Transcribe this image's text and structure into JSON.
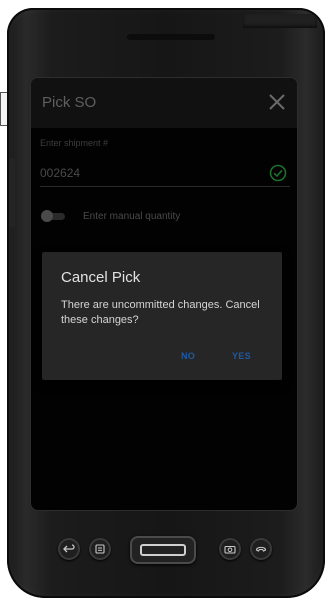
{
  "app": {
    "title": "Pick SO"
  },
  "form": {
    "shipment_label": "Enter shipment #",
    "shipment_value": "002624",
    "manual_quantity_label": "Enter manual quantity",
    "manual_quantity_enabled": false
  },
  "dialog": {
    "title": "Cancel Pick",
    "message": "There are uncommitted changes. Cancel these changes?",
    "no_label": "NO",
    "yes_label": "YES"
  },
  "icons": {
    "close": "close-icon",
    "valid": "check-circle-icon",
    "hw_back": "back-icon",
    "hw_menu": "menu-icon",
    "hw_scan": "scan-trigger-icon",
    "hw_camera": "camera-icon",
    "hw_phone": "phone-icon"
  },
  "colors": {
    "accent": "#1d5aa6",
    "valid_check": "#1f6f2c",
    "dialog_bg": "#262626",
    "screen_bg": "#020202"
  }
}
